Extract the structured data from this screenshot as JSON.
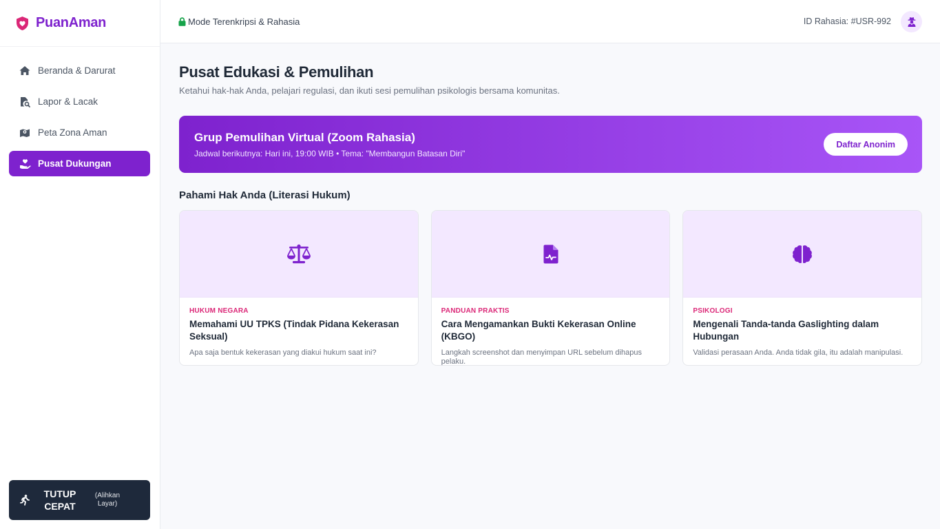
{
  "brand": {
    "name": "PuanAman",
    "logo_icon": "shield-heart-icon",
    "accent": "#7e22ce"
  },
  "sidebar": {
    "items": [
      {
        "label": "Beranda & Darurat",
        "icon": "home-icon",
        "active": false
      },
      {
        "label": "Lapor & Lacak",
        "icon": "file-search-icon",
        "active": false
      },
      {
        "label": "Peta Zona Aman",
        "icon": "map-icon",
        "active": false
      },
      {
        "label": "Pusat Dukungan",
        "icon": "hand-holding-heart-icon",
        "active": true
      }
    ],
    "panic": {
      "label": "TUTUP CEPAT",
      "sublabel": "(Alihkan Layar)",
      "icon": "running-person-icon"
    }
  },
  "header": {
    "secure_label": "Mode Terenkripsi & Rahasia",
    "secure_icon": "lock-icon",
    "secret_id": "ID Rahasia: #USR-992",
    "avatar_icon": "user-secret-icon"
  },
  "main": {
    "title": "Pusat Edukasi & Pemulihan",
    "subtitle": "Ketahui hak-hak Anda, pelajari regulasi, dan ikuti sesi pemulihan psikologis bersama komunitas.",
    "banner": {
      "title": "Grup Pemulihan Virtual (Zoom Rahasia)",
      "subtitle": "Jadwal berikutnya: Hari ini, 19:00 WIB • Tema: \"Membangun Batasan Diri\"",
      "button": "Daftar Anonim"
    },
    "section_title": "Pahami Hak Anda (Literasi Hukum)",
    "cards": [
      {
        "icon": "scale-balance-icon",
        "tag": "HUKUM NEGARA",
        "title": "Memahami UU TPKS (Tindak Pidana Kekerasan Seksual)",
        "desc": "Apa saja bentuk kekerasan yang diakui hukum saat ini?"
      },
      {
        "icon": "file-medical-icon",
        "tag": "PANDUAN PRAKTIS",
        "title": "Cara Mengamankan Bukti Kekerasan Online (KBGO)",
        "desc": "Langkah screenshot dan menyimpan URL sebelum dihapus pelaku."
      },
      {
        "icon": "brain-icon",
        "tag": "PSIKOLOGI",
        "title": "Mengenali Tanda-tanda Gaslighting dalam Hubungan",
        "desc": "Validasi perasaan Anda. Anda tidak gila, itu adalah manipulasi."
      }
    ]
  },
  "colors": {
    "tag": "#db2777",
    "panic_bg": "#1e293b",
    "card_media_bg": "#f3e8ff"
  }
}
